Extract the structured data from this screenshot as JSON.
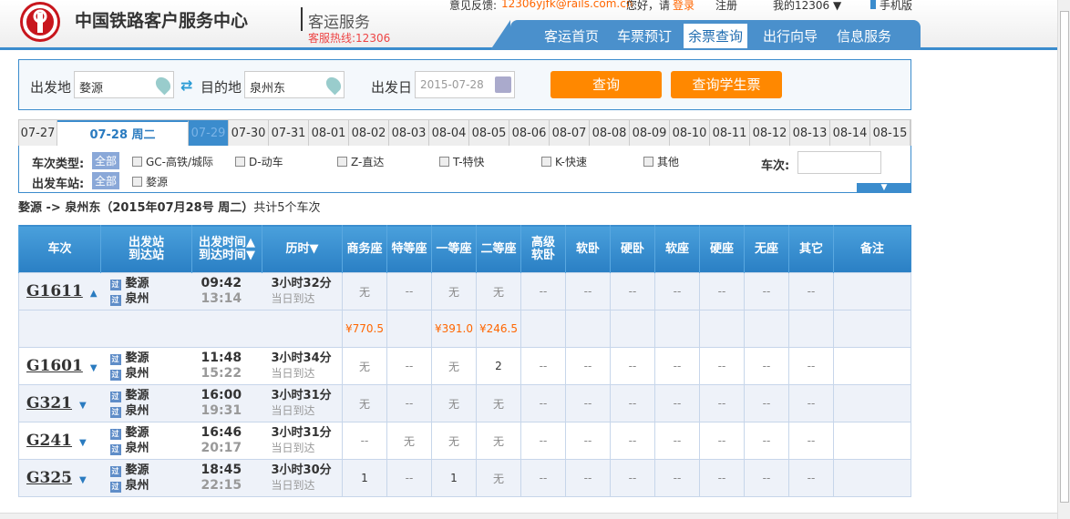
{
  "header": {
    "logo": "路",
    "title": "中国铁路客户服务中心",
    "subtitle": "客运服务",
    "hotline": "客服热线:12306",
    "feedback_label": "意见反馈:",
    "feedback_email": "12306yjfk@rails.com.cn",
    "greeting": "您好，请",
    "login": "登录",
    "register": "注册",
    "my12306": "我的12306 ▼",
    "mobile": "手机版",
    "nav": [
      "客运首页",
      "车票预订",
      "余票查询",
      "出行向导",
      "信息服务"
    ],
    "nav_active": 2
  },
  "search": {
    "from_label": "出发地",
    "from_value": "婺源",
    "to_label": "目的地",
    "to_value": "泉州东",
    "date_label": "出发日",
    "date_value": "2015-07-28",
    "query_btn": "查询",
    "student_btn": "查询学生票"
  },
  "dates": [
    "07-27",
    "07-28 周二",
    "07-29",
    "07-30",
    "07-31",
    "08-01",
    "08-02",
    "08-03",
    "08-04",
    "08-05",
    "08-06",
    "08-07",
    "08-08",
    "08-09",
    "08-10",
    "08-11",
    "08-12",
    "08-13",
    "08-14",
    "08-15"
  ],
  "filters": {
    "type_label": "车次类型:",
    "all": "全部",
    "types": [
      "GC-高铁/城际",
      "D-动车",
      "Z-直达",
      "T-特快",
      "K-快速",
      "其他"
    ],
    "station_label": "出发车站:",
    "stations": [
      "婺源"
    ],
    "train_no_label": "车次:"
  },
  "summary": {
    "route": "婺源 -> 泉州东（2015年07月28号  周二）",
    "count": "共计5个车次"
  },
  "table": {
    "headers": [
      "车次",
      "出发站\n到达站",
      "出发时间▲\n到达时间▼",
      "历时▼",
      "商务座",
      "特等座",
      "一等座",
      "二等座",
      "高级\n软卧",
      "软卧",
      "硬卧",
      "软座",
      "硬座",
      "无座",
      "其它",
      "备注"
    ],
    "rows": [
      {
        "train": "G1611",
        "expanded": true,
        "from": "婺源",
        "to": "泉州",
        "dep": "09:42",
        "arr": "13:14",
        "duration": "3小时32分",
        "arrive_note": "当日到达",
        "seats": [
          "无",
          "--",
          "无",
          "无",
          "--",
          "--",
          "--",
          "--",
          "--",
          "--",
          "--"
        ],
        "prices": [
          "¥770.5",
          "",
          "¥391.0",
          "¥246.5",
          "",
          "",
          "",
          "",
          "",
          "",
          ""
        ]
      },
      {
        "train": "G1601",
        "from": "婺源",
        "to": "泉州",
        "dep": "11:48",
        "arr": "15:22",
        "duration": "3小时34分",
        "arrive_note": "当日到达",
        "seats": [
          "无",
          "--",
          "无",
          "2",
          "--",
          "--",
          "--",
          "--",
          "--",
          "--",
          "--"
        ]
      },
      {
        "train": "G321",
        "from": "婺源",
        "to": "泉州",
        "dep": "16:00",
        "arr": "19:31",
        "duration": "3小时31分",
        "arrive_note": "当日到达",
        "seats": [
          "无",
          "--",
          "无",
          "无",
          "--",
          "--",
          "--",
          "--",
          "--",
          "--",
          "--"
        ]
      },
      {
        "train": "G241",
        "from": "婺源",
        "to": "泉州",
        "dep": "16:46",
        "arr": "20:17",
        "duration": "3小时31分",
        "arrive_note": "当日到达",
        "seats": [
          "--",
          "无",
          "无",
          "无",
          "--",
          "--",
          "--",
          "--",
          "--",
          "--",
          "--"
        ]
      },
      {
        "train": "G325",
        "from": "婺源",
        "to": "泉州",
        "dep": "18:45",
        "arr": "22:15",
        "duration": "3小时30分",
        "arrive_note": "当日到达",
        "seats": [
          "1",
          "--",
          "1",
          "无",
          "--",
          "--",
          "--",
          "--",
          "--",
          "--",
          "--"
        ]
      }
    ],
    "pass_tag": "过"
  }
}
